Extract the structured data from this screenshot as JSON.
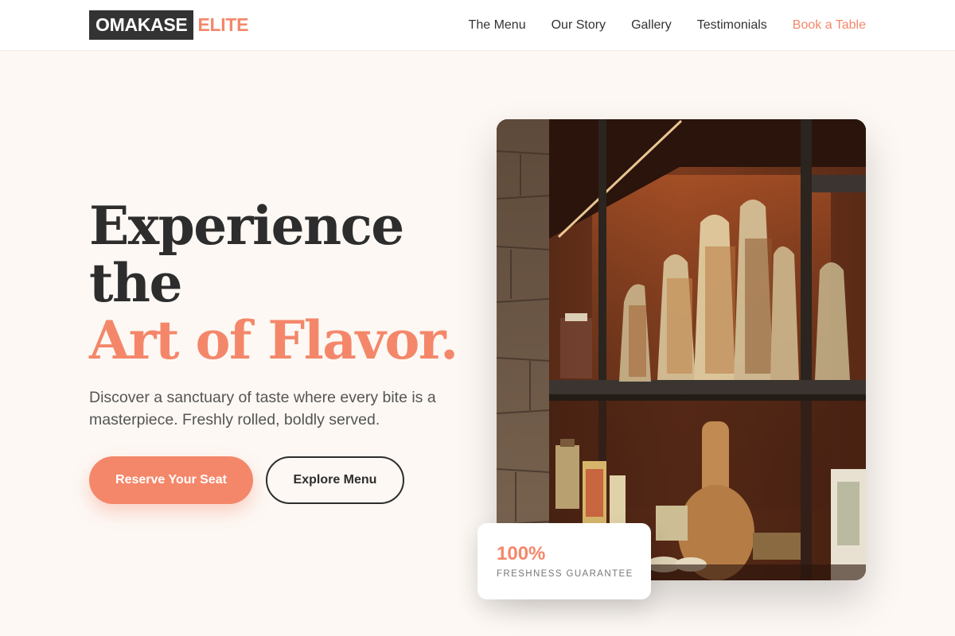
{
  "brand": {
    "name_primary": "OMAKASE",
    "name_accent": "ELITE"
  },
  "nav": {
    "items": [
      {
        "label": "The Menu"
      },
      {
        "label": "Our Story"
      },
      {
        "label": "Gallery"
      },
      {
        "label": "Testimonials"
      },
      {
        "label": "Book a Table"
      }
    ]
  },
  "hero": {
    "title_line1": "Experience",
    "title_line2": "the",
    "title_accent": "Art of Flavor.",
    "subtitle": "Discover a sanctuary of taste where every bite is a masterpiece. Freshly rolled, boldly served.",
    "primary_button": "Reserve Your Seat",
    "secondary_button": "Explore Menu"
  },
  "badge": {
    "value": "100%",
    "label": "FRESHNESS GUARANTEE"
  },
  "colors": {
    "accent": "#f4876a",
    "dark": "#2d2d2d",
    "background": "#fdf8f4"
  }
}
